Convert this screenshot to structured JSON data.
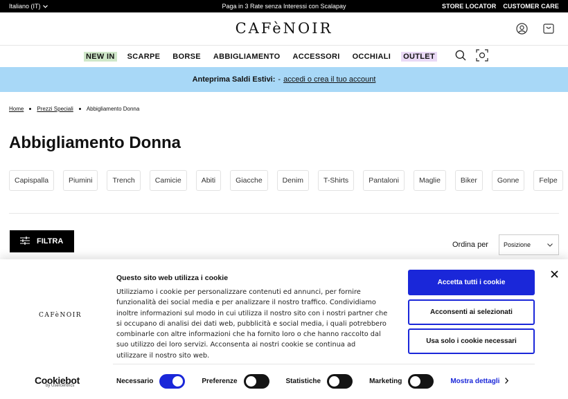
{
  "topbar": {
    "language": "Italiano (IT)",
    "promo": "Paga in 3 Rate senza Interessi con Scalapay",
    "store_locator": "STORE LOCATOR",
    "customer_care": "CUSTOMER CARE"
  },
  "header": {
    "logo": "CAFèNOIR"
  },
  "nav": {
    "items": [
      "NEW IN",
      "SCARPE",
      "BORSE",
      "ABBIGLIAMENTO",
      "ACCESSORI",
      "OCCHIALI",
      "OUTLET"
    ]
  },
  "promo_banner": {
    "bold": "Anteprima Saldi Estivi:",
    "dash": "-",
    "link": "accedi o crea il tuo account"
  },
  "breadcrumb": [
    "Home",
    "Prezzi Speciali",
    "Abbigliamento Donna"
  ],
  "page_title": "Abbigliamento Donna",
  "categories": [
    "Capispalla",
    "Piumini",
    "Trench",
    "Camicie",
    "Abiti",
    "Giacche",
    "Denim",
    "T-Shirts",
    "Pantaloni",
    "Maglie",
    "Biker",
    "Gonne",
    "Felpe"
  ],
  "toolbar": {
    "filter_label": "FILTRA",
    "sort_label": "Ordina per",
    "sort_value": "Posizione"
  },
  "cookie": {
    "logo": "CAFèNOIR",
    "title": "Questo sito web utilizza i cookie",
    "text": "Utilizziamo i cookie per personalizzare contenuti ed annunci, per fornire funzionalità dei social media e per analizzare il nostro traffico. Condividiamo inoltre informazioni sul modo in cui utilizza il nostro sito con i nostri partner che si occupano di analisi dei dati web, pubblicità e social media, i quali potrebbero combinarle con altre informazioni che ha fornito loro o che hanno raccolto dal suo utilizzo dei loro servizi. Acconsenta ai nostri cookie se continua ad utilizzare il nostro sito web.",
    "accept_all": "Accetta tutti i cookie",
    "accept_selected": "Acconsenti ai selezionati",
    "necessary_only": "Usa solo i cookie necessari",
    "brand": "Cookiebot",
    "brand_sub": "by Usercentrics",
    "toggles": [
      {
        "label": "Necessario",
        "on": true
      },
      {
        "label": "Preferenze",
        "on": false
      },
      {
        "label": "Statistiche",
        "on": false
      },
      {
        "label": "Marketing",
        "on": false
      }
    ],
    "more_details": "Mostra dettagli",
    "accent_color": "#1a27d9"
  },
  "colors": {
    "promo_bg": "#a8d8f7",
    "newin_bg": "#cfe7c9",
    "outlet_bg": "#e9d9f5"
  }
}
